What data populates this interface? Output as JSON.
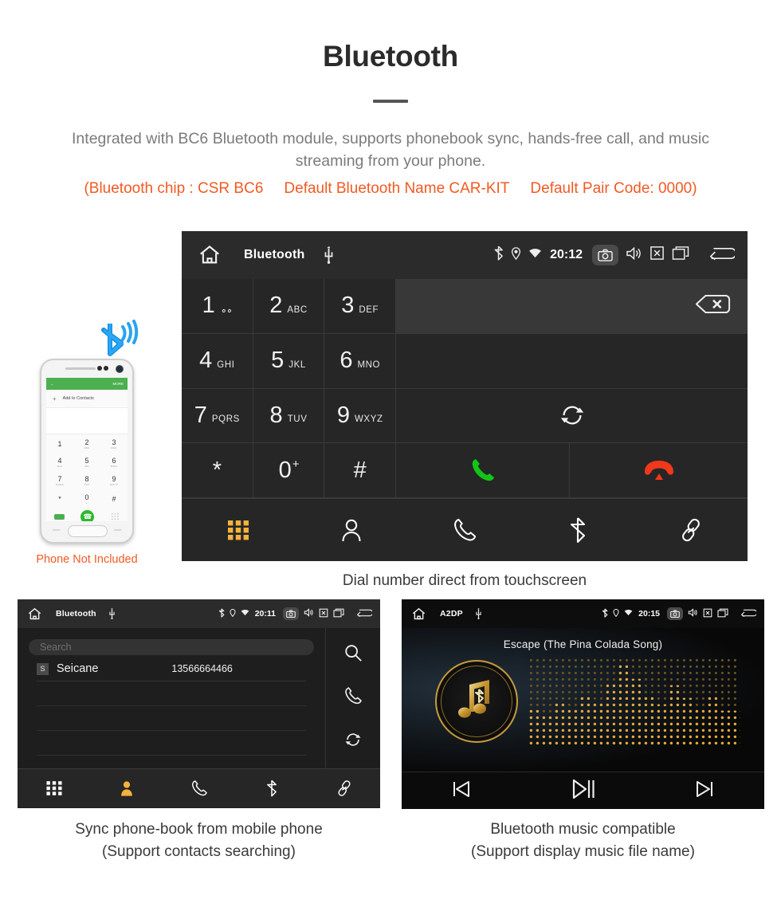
{
  "header": {
    "title": "Bluetooth",
    "subtitle": "Integrated with BC6 Bluetooth module, supports phonebook sync, hands-free call, and music streaming from your phone.",
    "spec_chip": "(Bluetooth chip : CSR BC6",
    "spec_name": "Default Bluetooth Name CAR-KIT",
    "spec_pair": "Default Pair Code: 0000)",
    "accent_color": "#f15a24",
    "subtitle_color": "#7b7b7b"
  },
  "phone_mock": {
    "app_back": "←",
    "app_more": "MORE",
    "add_contacts": "Add to Contacts",
    "plus": "+",
    "keys": [
      {
        "digit": "1",
        "letters": ""
      },
      {
        "digit": "2",
        "letters": "ABC"
      },
      {
        "digit": "3",
        "letters": "DEF"
      },
      {
        "digit": "4",
        "letters": "GHI"
      },
      {
        "digit": "5",
        "letters": "JKL"
      },
      {
        "digit": "6",
        "letters": "MNO"
      },
      {
        "digit": "7",
        "letters": "PQRS"
      },
      {
        "digit": "8",
        "letters": "TUV"
      },
      {
        "digit": "9",
        "letters": "WXYZ"
      },
      {
        "digit": "*",
        "letters": ""
      },
      {
        "digit": "0",
        "letters": "+"
      },
      {
        "digit": "#",
        "letters": ""
      }
    ],
    "note": "Phone Not Included"
  },
  "dialer": {
    "statusbar": {
      "home_icon": "home-icon",
      "title": "Bluetooth",
      "usb_icon": "usb-icon",
      "bluetooth_icon": "bluetooth-icon",
      "location_icon": "location-icon",
      "wifi_icon": "wifi-icon",
      "clock": "20:12",
      "camera_icon": "camera-icon",
      "volume_icon": "volume-icon",
      "close_icon": "close-box-icon",
      "recents_icon": "recents-icon",
      "back_icon": "back-icon"
    },
    "keys": [
      {
        "digit": "1",
        "letters": "",
        "voicemail": true
      },
      {
        "digit": "2",
        "letters": "ABC"
      },
      {
        "digit": "3",
        "letters": "DEF"
      },
      {
        "digit": "4",
        "letters": "GHI"
      },
      {
        "digit": "5",
        "letters": "JKL"
      },
      {
        "digit": "6",
        "letters": "MNO"
      },
      {
        "digit": "7",
        "letters": "PQRS"
      },
      {
        "digit": "8",
        "letters": "TUV"
      },
      {
        "digit": "9",
        "letters": "WXYZ"
      },
      {
        "digit": "*",
        "letters": ""
      },
      {
        "digit": "0",
        "letters": "+"
      },
      {
        "digit": "#",
        "letters": ""
      }
    ],
    "number_display": "",
    "backspace_icon": "backspace-icon",
    "sync_icon": "sync-icon",
    "call_icon": "call-icon",
    "hangup_icon": "hangup-icon",
    "call_color": "#12c516",
    "hangup_color": "#f0381a",
    "nav": [
      {
        "name": "keypad",
        "icon": "keypad-icon",
        "active": true
      },
      {
        "name": "contacts",
        "icon": "person-icon",
        "active": false
      },
      {
        "name": "call-log",
        "icon": "phone-icon",
        "active": false
      },
      {
        "name": "bluetooth",
        "icon": "bluetooth-icon",
        "active": false
      },
      {
        "name": "link",
        "icon": "link-icon",
        "active": false
      }
    ],
    "active_color": "#f5b33c",
    "caption": "Dial number direct from touchscreen"
  },
  "contacts": {
    "statusbar": {
      "title": "Bluetooth",
      "clock": "20:11"
    },
    "search_placeholder": "Search",
    "rows": [
      {
        "initial": "S",
        "name": "Seicane",
        "number": "13566664466"
      }
    ],
    "side_actions": [
      {
        "name": "search",
        "icon": "search-icon"
      },
      {
        "name": "call",
        "icon": "phone-icon"
      },
      {
        "name": "sync",
        "icon": "sync-icon"
      }
    ],
    "nav": [
      {
        "name": "keypad",
        "icon": "keypad-icon",
        "active": false
      },
      {
        "name": "contacts",
        "icon": "person-icon",
        "active": true
      },
      {
        "name": "call-log",
        "icon": "phone-icon",
        "active": false
      },
      {
        "name": "bluetooth",
        "icon": "bluetooth-icon",
        "active": false
      },
      {
        "name": "link",
        "icon": "link-icon",
        "active": false
      }
    ],
    "caption_line1": "Sync phone-book from mobile phone",
    "caption_line2": "(Support contacts searching)"
  },
  "music": {
    "statusbar": {
      "title": "A2DP",
      "clock": "20:15"
    },
    "song_title": "Escape (The Pina Colada Song)",
    "album_icon": "music-note-bluetooth-icon",
    "controls": [
      {
        "name": "previous",
        "icon": "prev-track-icon"
      },
      {
        "name": "play-pause",
        "icon": "play-pause-icon"
      },
      {
        "name": "next",
        "icon": "next-track-icon"
      }
    ],
    "accent_color": "#d9a441",
    "caption_line1": "Bluetooth music compatible",
    "caption_line2": "(Support display music file name)"
  }
}
